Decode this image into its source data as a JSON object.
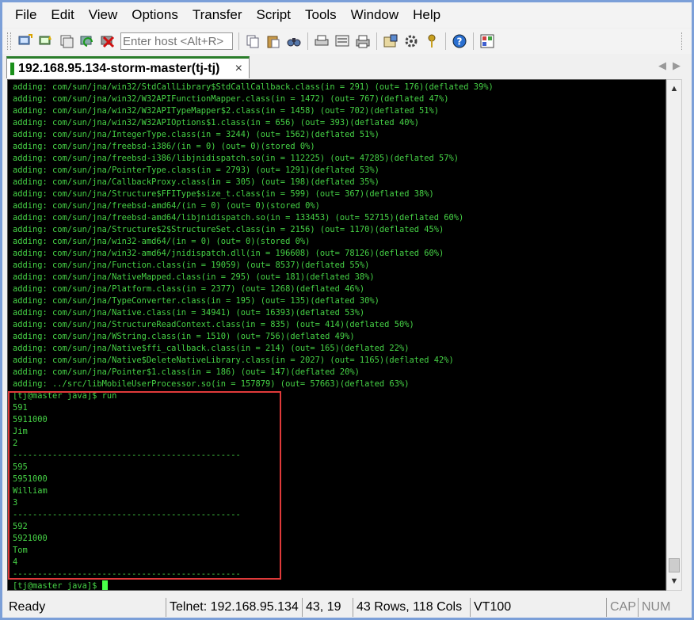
{
  "menu": [
    "File",
    "Edit",
    "View",
    "Options",
    "Transfer",
    "Script",
    "Tools",
    "Window",
    "Help"
  ],
  "toolbar": {
    "host_placeholder": "Enter host <Alt+R>"
  },
  "tab": {
    "label": "192.168.95.134-storm-master(tj-tj)",
    "close": "×"
  },
  "terminal": {
    "lines": [
      "adding: com/sun/jna/win32/StdCallLibrary$StdCallCallback.class(in = 291) (out= 176)(deflated 39%)",
      "adding: com/sun/jna/win32/W32APIFunctionMapper.class(in = 1472) (out= 767)(deflated 47%)",
      "adding: com/sun/jna/win32/W32APITypeMapper$2.class(in = 1458) (out= 702)(deflated 51%)",
      "adding: com/sun/jna/win32/W32APIOptions$1.class(in = 656) (out= 393)(deflated 40%)",
      "adding: com/sun/jna/IntegerType.class(in = 3244) (out= 1562)(deflated 51%)",
      "adding: com/sun/jna/freebsd-i386/(in = 0) (out= 0)(stored 0%)",
      "adding: com/sun/jna/freebsd-i386/libjnidispatch.so(in = 112225) (out= 47285)(deflated 57%)",
      "adding: com/sun/jna/PointerType.class(in = 2793) (out= 1291)(deflated 53%)",
      "adding: com/sun/jna/CallbackProxy.class(in = 305) (out= 198)(deflated 35%)",
      "adding: com/sun/jna/Structure$FFIType$size_t.class(in = 599) (out= 367)(deflated 38%)",
      "adding: com/sun/jna/freebsd-amd64/(in = 0) (out= 0)(stored 0%)",
      "adding: com/sun/jna/freebsd-amd64/libjnidispatch.so(in = 133453) (out= 52715)(deflated 60%)",
      "adding: com/sun/jna/Structure$2$StructureSet.class(in = 2156) (out= 1170)(deflated 45%)",
      "adding: com/sun/jna/win32-amd64/(in = 0) (out= 0)(stored 0%)",
      "adding: com/sun/jna/win32-amd64/jnidispatch.dll(in = 196608) (out= 78126)(deflated 60%)",
      "adding: com/sun/jna/Function.class(in = 19059) (out= 8537)(deflated 55%)",
      "adding: com/sun/jna/NativeMapped.class(in = 295) (out= 181)(deflated 38%)",
      "adding: com/sun/jna/Platform.class(in = 2377) (out= 1268)(deflated 46%)",
      "adding: com/sun/jna/TypeConverter.class(in = 195) (out= 135)(deflated 30%)",
      "adding: com/sun/jna/Native.class(in = 34941) (out= 16393)(deflated 53%)",
      "adding: com/sun/jna/StructureReadContext.class(in = 835) (out= 414)(deflated 50%)",
      "adding: com/sun/jna/WString.class(in = 1510) (out= 756)(deflated 49%)",
      "adding: com/sun/jna/Native$ffi_callback.class(in = 214) (out= 165)(deflated 22%)",
      "adding: com/sun/jna/Native$DeleteNativeLibrary.class(in = 2027) (out= 1165)(deflated 42%)",
      "adding: com/sun/jna/Pointer$1.class(in = 186) (out= 147)(deflated 20%)",
      "adding: ../src/libMobileUserProcessor.so(in = 157879) (out= 57663)(deflated 63%)",
      "[tj@master java]$ run",
      "591",
      "5911000",
      "Jim",
      "2",
      "----------------------------------------------",
      "595",
      "5951000",
      "William",
      "3",
      "----------------------------------------------",
      "592",
      "5921000",
      "Tom",
      "4",
      "----------------------------------------------"
    ],
    "prompt": "[tj@master java]$ "
  },
  "status": {
    "ready": "Ready",
    "connection": "Telnet: 192.168.95.134",
    "cursor_pos": "43,  19",
    "size": "43 Rows, 118 Cols",
    "emulation": "VT100",
    "cap": "CAP",
    "num": "NUM"
  }
}
